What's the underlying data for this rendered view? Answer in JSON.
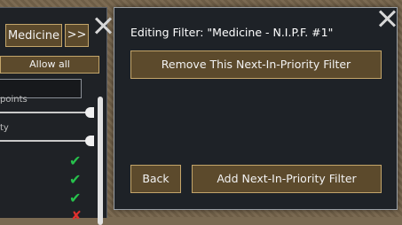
{
  "background_panel": {
    "tab_label": "Medicine",
    "next_label": ">>",
    "allow_all_label": "Allow all",
    "search_value": "",
    "row1_label": "points",
    "row2_label": "ty",
    "check_glyph": "✔",
    "cross_glyph": "✘"
  },
  "dialog": {
    "title": "Editing Filter: \"Medicine - N.I.P.F. #1\"",
    "remove_button": "Remove This Next-In-Priority Filter",
    "back_button": "Back",
    "add_button": "Add Next-In-Priority Filter"
  },
  "colors": {
    "button_fill": "#5c4a2c",
    "button_border": "#c3a56a",
    "panel_bg": "#1e2227",
    "check_green": "#27c24c",
    "cross_red": "#e0302d"
  }
}
